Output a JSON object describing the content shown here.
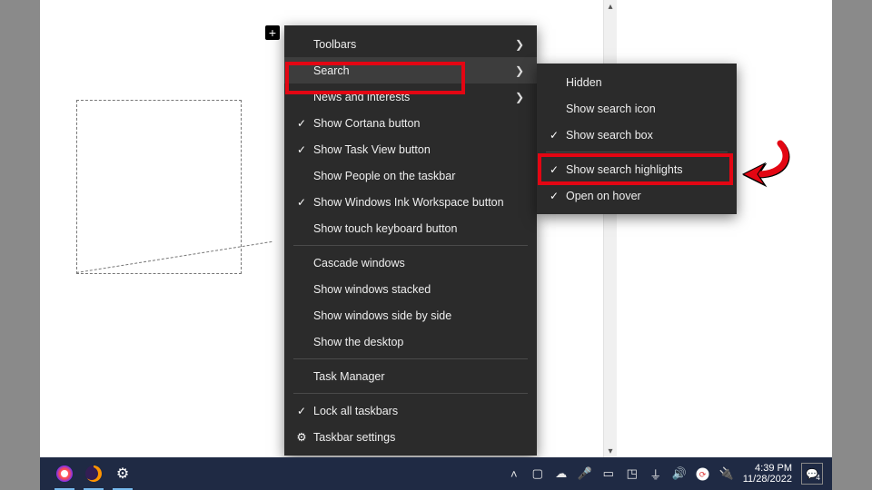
{
  "bg": {
    "plus": "+"
  },
  "main_menu": {
    "items": [
      {
        "label": "Toolbars",
        "arrow": true,
        "check": false
      },
      {
        "label": "Search",
        "arrow": true,
        "check": false,
        "hover": true,
        "highlight": true
      },
      {
        "label": "News and interests",
        "arrow": true,
        "check": false
      },
      {
        "label": "Show Cortana button",
        "check": true
      },
      {
        "label": "Show Task View button",
        "check": true
      },
      {
        "label": "Show People on the taskbar",
        "check": false
      },
      {
        "label": "Show Windows Ink Workspace button",
        "check": true
      },
      {
        "label": "Show touch keyboard button",
        "check": false
      }
    ],
    "group2": [
      {
        "label": "Cascade windows"
      },
      {
        "label": "Show windows stacked"
      },
      {
        "label": "Show windows side by side"
      },
      {
        "label": "Show the desktop"
      }
    ],
    "group3": [
      {
        "label": "Task Manager"
      }
    ],
    "group4": [
      {
        "label": "Lock all taskbars",
        "check": true
      },
      {
        "label": "Taskbar settings",
        "gear": true
      }
    ]
  },
  "sub_menu": {
    "items": [
      {
        "label": "Hidden",
        "check": false
      },
      {
        "label": "Show search icon",
        "check": false
      },
      {
        "label": "Show search box",
        "check": true
      }
    ],
    "group2": [
      {
        "label": "Show search highlights",
        "check": true,
        "highlight": true
      },
      {
        "label": "Open on hover",
        "check": true
      }
    ]
  },
  "taskbar": {
    "time": "4:39 PM",
    "date": "11/28/2022",
    "action_center_badge": "4"
  }
}
